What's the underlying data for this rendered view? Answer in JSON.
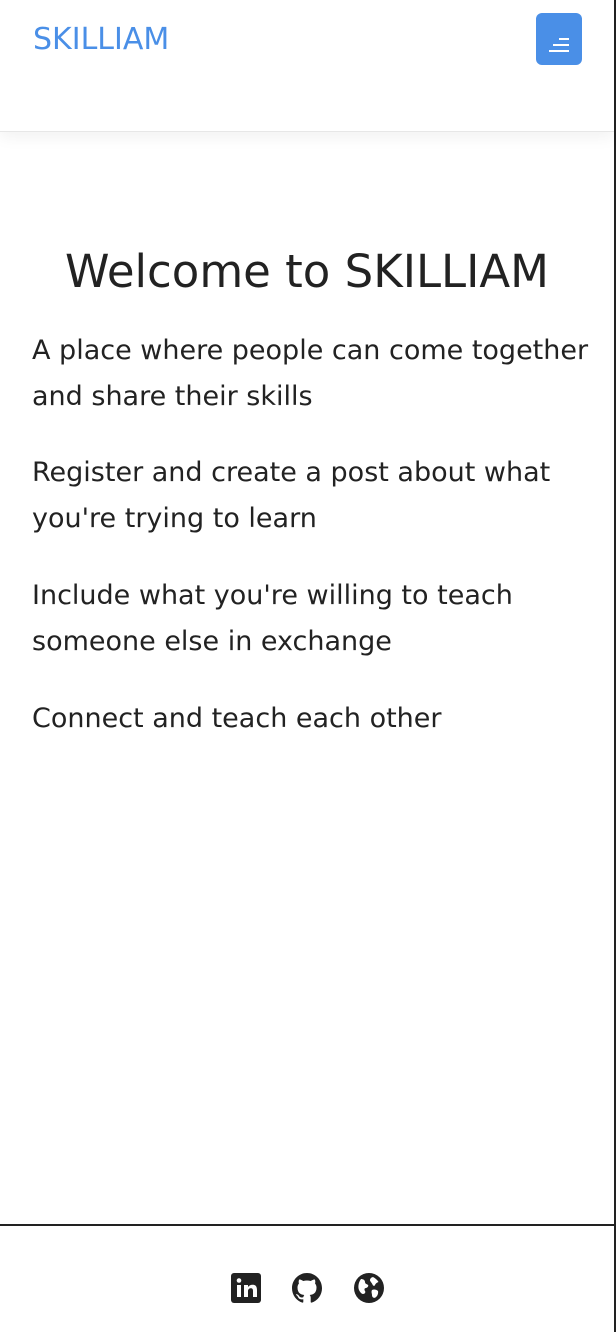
{
  "navbar": {
    "brand": "SKILLIAM",
    "menu_icon": "hamburger-menu-icon"
  },
  "main": {
    "title": "Welcome to SKILLIAM",
    "paragraphs": [
      "A place where people can come together and share their skills",
      "Register and create a post about what you're trying to learn",
      "Include what you're willing to teach someone else in exchange",
      "Connect and teach each other"
    ]
  },
  "footer": {
    "icons": [
      "linkedin-icon",
      "github-icon",
      "globe-icon"
    ]
  },
  "colors": {
    "accent": "#4a8fe7",
    "text": "#222222",
    "background": "#ffffff",
    "border": "#222222"
  }
}
